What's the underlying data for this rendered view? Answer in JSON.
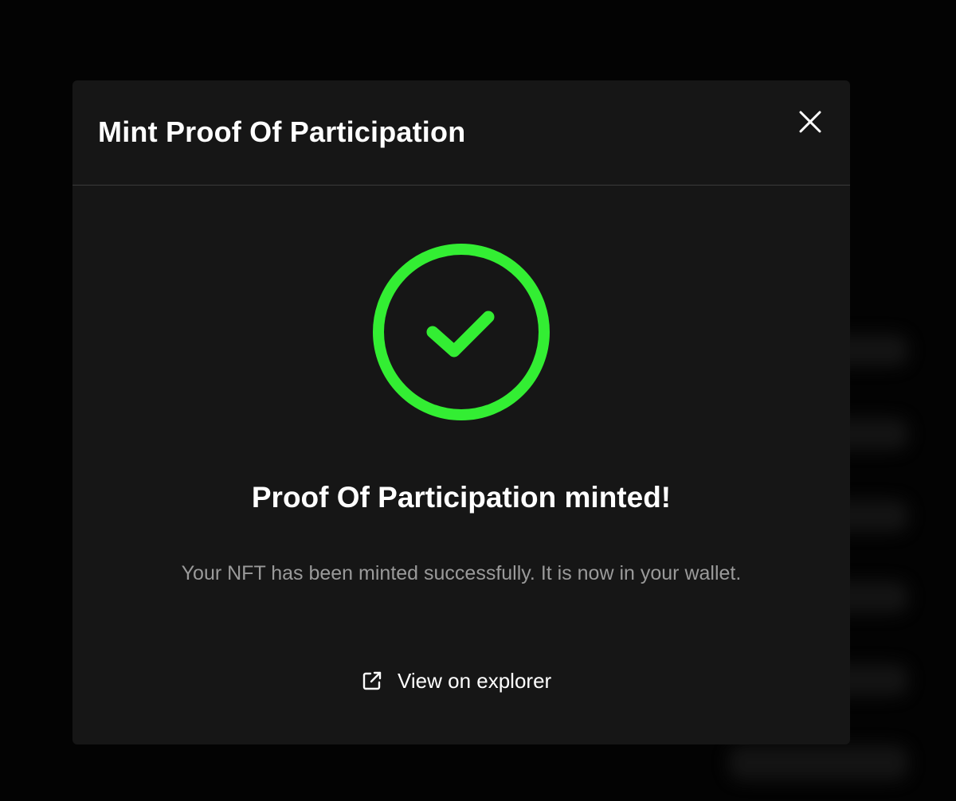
{
  "modal": {
    "title": "Mint Proof Of Participation",
    "close_icon": "close-icon",
    "status_icon": "check-circle-icon",
    "accent_color": "#33ee33",
    "success_title": "Proof Of Participation minted!",
    "success_message": "Your NFT has been minted successfully. It is now in your wallet.",
    "explorer_link": {
      "icon": "external-link-icon",
      "label": "View on explorer"
    }
  }
}
